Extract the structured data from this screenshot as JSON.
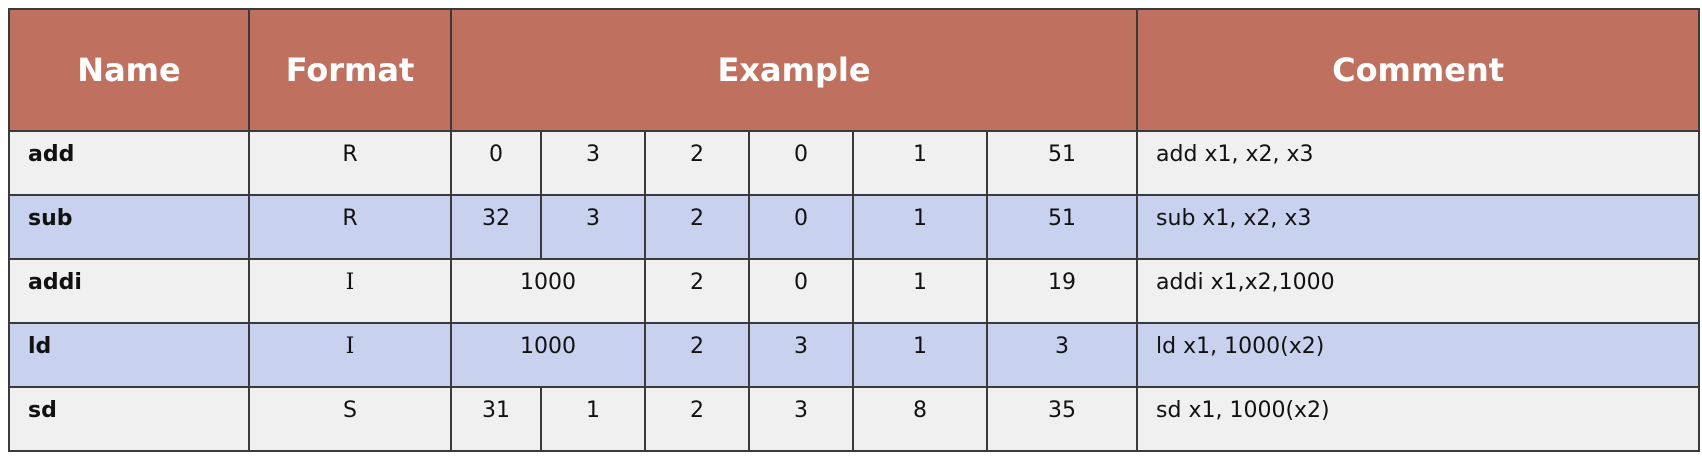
{
  "table": {
    "headers": {
      "name": "Name",
      "format": "Format",
      "example": "Example",
      "comment": "Comment"
    },
    "rows": [
      {
        "name": "add",
        "format": "R",
        "fields": [
          "0",
          "3",
          "2",
          "0",
          "1",
          "51"
        ],
        "comment": "add x1, x2, x3"
      },
      {
        "name": "sub",
        "format": "R",
        "fields": [
          "32",
          "3",
          "2",
          "0",
          "1",
          "51"
        ],
        "comment": "sub x1, x2, x3"
      },
      {
        "name": "addi",
        "format": "I",
        "fields": [
          "1000",
          "2",
          "0",
          "1",
          "19"
        ],
        "comment": "addi x1,x2,1000"
      },
      {
        "name": "ld",
        "format": "I",
        "fields": [
          "1000",
          "2",
          "3",
          "1",
          "3"
        ],
        "comment": "ld x1, 1000(x2)"
      },
      {
        "name": "sd",
        "format": "S",
        "fields": [
          "31",
          "1",
          "2",
          "3",
          "8",
          "35"
        ],
        "comment": "sd x1, 1000(x2)"
      }
    ]
  },
  "colors": {
    "header_bg": "#c0705f",
    "row_plain_bg": "#f0f0f0",
    "row_shaded_bg": "#c8d2ef",
    "border": "#3a3a3a"
  }
}
